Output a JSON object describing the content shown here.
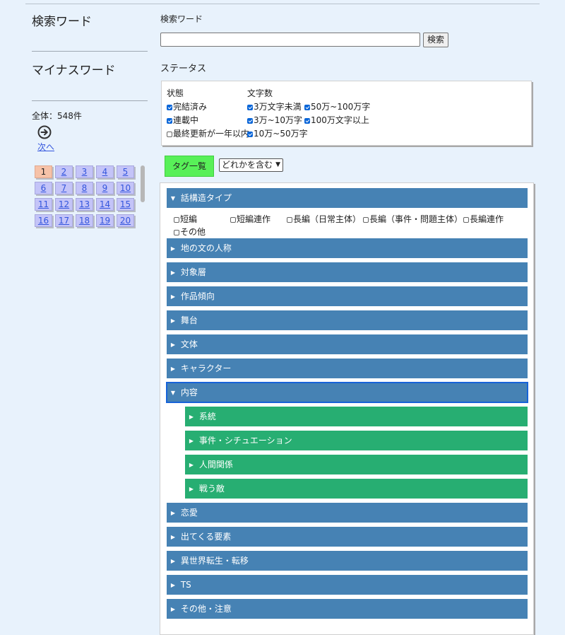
{
  "sidebar": {
    "search_heading": "検索ワード",
    "minus_heading": "マイナスワード",
    "total_text": "全体：548件",
    "next_label": "次へ",
    "pages": [
      "1",
      "2",
      "3",
      "4",
      "5",
      "6",
      "7",
      "8",
      "9",
      "10",
      "11",
      "12",
      "13",
      "14",
      "15",
      "16",
      "17",
      "18",
      "19",
      "20"
    ],
    "current_page": "1"
  },
  "search": {
    "label": "検索ワード",
    "value": "",
    "button": "検索"
  },
  "status": {
    "heading": "ステータス",
    "state_heading": "状態",
    "length_heading": "文字数",
    "state_options": [
      {
        "label": "完結済み",
        "checked": true
      },
      {
        "label": "連載中",
        "checked": true
      },
      {
        "label": "最終更新が一年以内",
        "checked": false
      }
    ],
    "length_options": [
      {
        "label": "3万文字未満",
        "checked": true
      },
      {
        "label": "50万~100万字",
        "checked": true
      },
      {
        "label": "3万~10万字",
        "checked": true
      },
      {
        "label": "100万文字以上",
        "checked": true
      },
      {
        "label": "10万~50万字",
        "checked": true
      }
    ]
  },
  "tags": {
    "button": "タグ一覧",
    "mode": "どれかを含む",
    "categories": [
      {
        "label": "話構造タイプ",
        "expanded": true
      },
      {
        "label": "地の文の人称",
        "expanded": false
      },
      {
        "label": "対象層",
        "expanded": false
      },
      {
        "label": "作品傾向",
        "expanded": false
      },
      {
        "label": "舞台",
        "expanded": false
      },
      {
        "label": "文体",
        "expanded": false
      },
      {
        "label": "キャラクター",
        "expanded": false
      },
      {
        "label": "内容",
        "expanded": true
      },
      {
        "label": "恋愛",
        "expanded": false
      },
      {
        "label": "出てくる要素",
        "expanded": false
      },
      {
        "label": "異世界転生・転移",
        "expanded": false
      },
      {
        "label": "TS",
        "expanded": false
      },
      {
        "label": "その他・注意",
        "expanded": false
      }
    ],
    "structure_options": [
      "短編",
      "短編連作",
      "長編（日常主体）",
      "長編（事件・問題主体）",
      "長編連作",
      "その他"
    ],
    "content_subcategories": [
      "系統",
      "事件・シチュエーション",
      "人間関係",
      "戦う敵"
    ]
  },
  "colors": {
    "category_bar": "#4682b4",
    "subcategory_bar": "#27ae72",
    "tag_button": "#58f058",
    "current_page": "#f6c2a8",
    "page_cell": "#c4c4f8"
  }
}
